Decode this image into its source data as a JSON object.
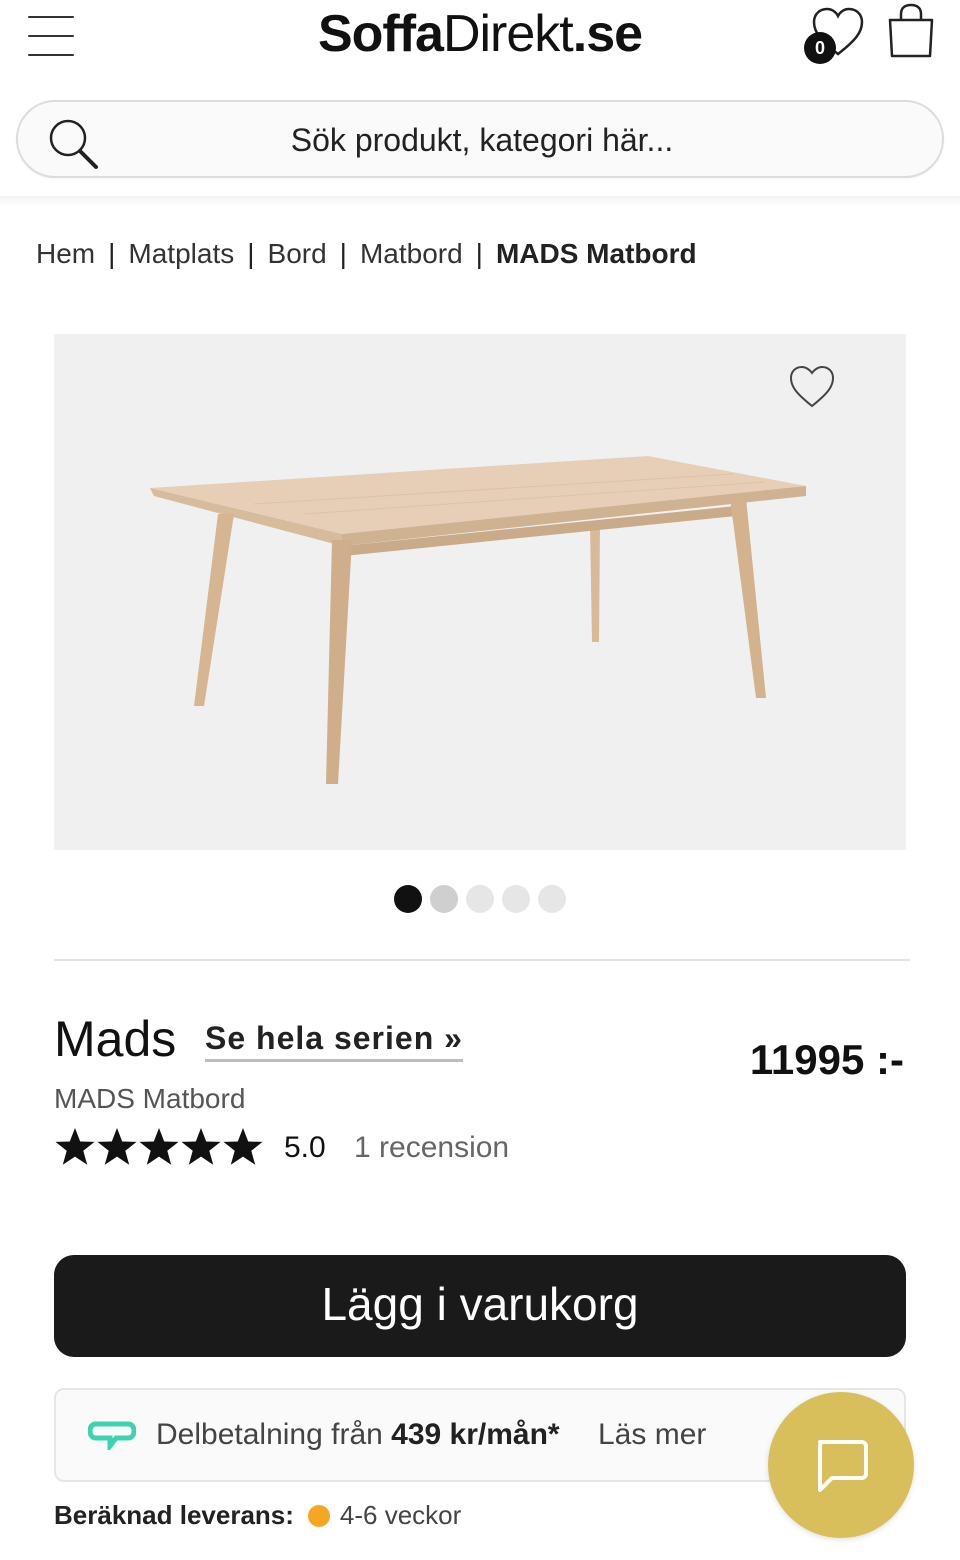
{
  "header": {
    "logo": {
      "part1": "Soffa",
      "part2": "Direkt",
      "part3": ".se"
    },
    "wishlist_count": "0",
    "search_placeholder": "Sök produkt, kategori här..."
  },
  "breadcrumb": {
    "items": [
      "Hem",
      "Matplats",
      "Bord",
      "Matbord"
    ],
    "current": "MADS Matbord",
    "separator": "|"
  },
  "gallery": {
    "image_alt": "MADS Matbord",
    "dots": [
      {
        "color": "#111111",
        "active": true
      },
      {
        "color": "#cfcfcf",
        "active": false
      },
      {
        "color": "#e6e6e6",
        "active": false
      },
      {
        "color": "#e6e6e6",
        "active": false
      },
      {
        "color": "#e6e6e6",
        "active": false
      }
    ]
  },
  "product": {
    "name": "Mads",
    "series_link": "Se hela serien »",
    "subtitle": "MADS Matbord",
    "price": "11995 :-",
    "rating": "5.0",
    "stars": 5,
    "reviews": "1 recension"
  },
  "actions": {
    "add_to_cart": "Lägg i varukorg"
  },
  "financing": {
    "text_prefix": "Delbetalning från ",
    "amount": "439 kr/mån*",
    "read_more": "Läs mer",
    "icon_color": "#3ed3b0"
  },
  "delivery": {
    "label": "Beräknad leverans:",
    "time": "4-6 veckor",
    "status_color": "#f5a623"
  },
  "colors": {
    "chat_button": "#d9bf5b",
    "cart_button": "#1a1a1a"
  }
}
